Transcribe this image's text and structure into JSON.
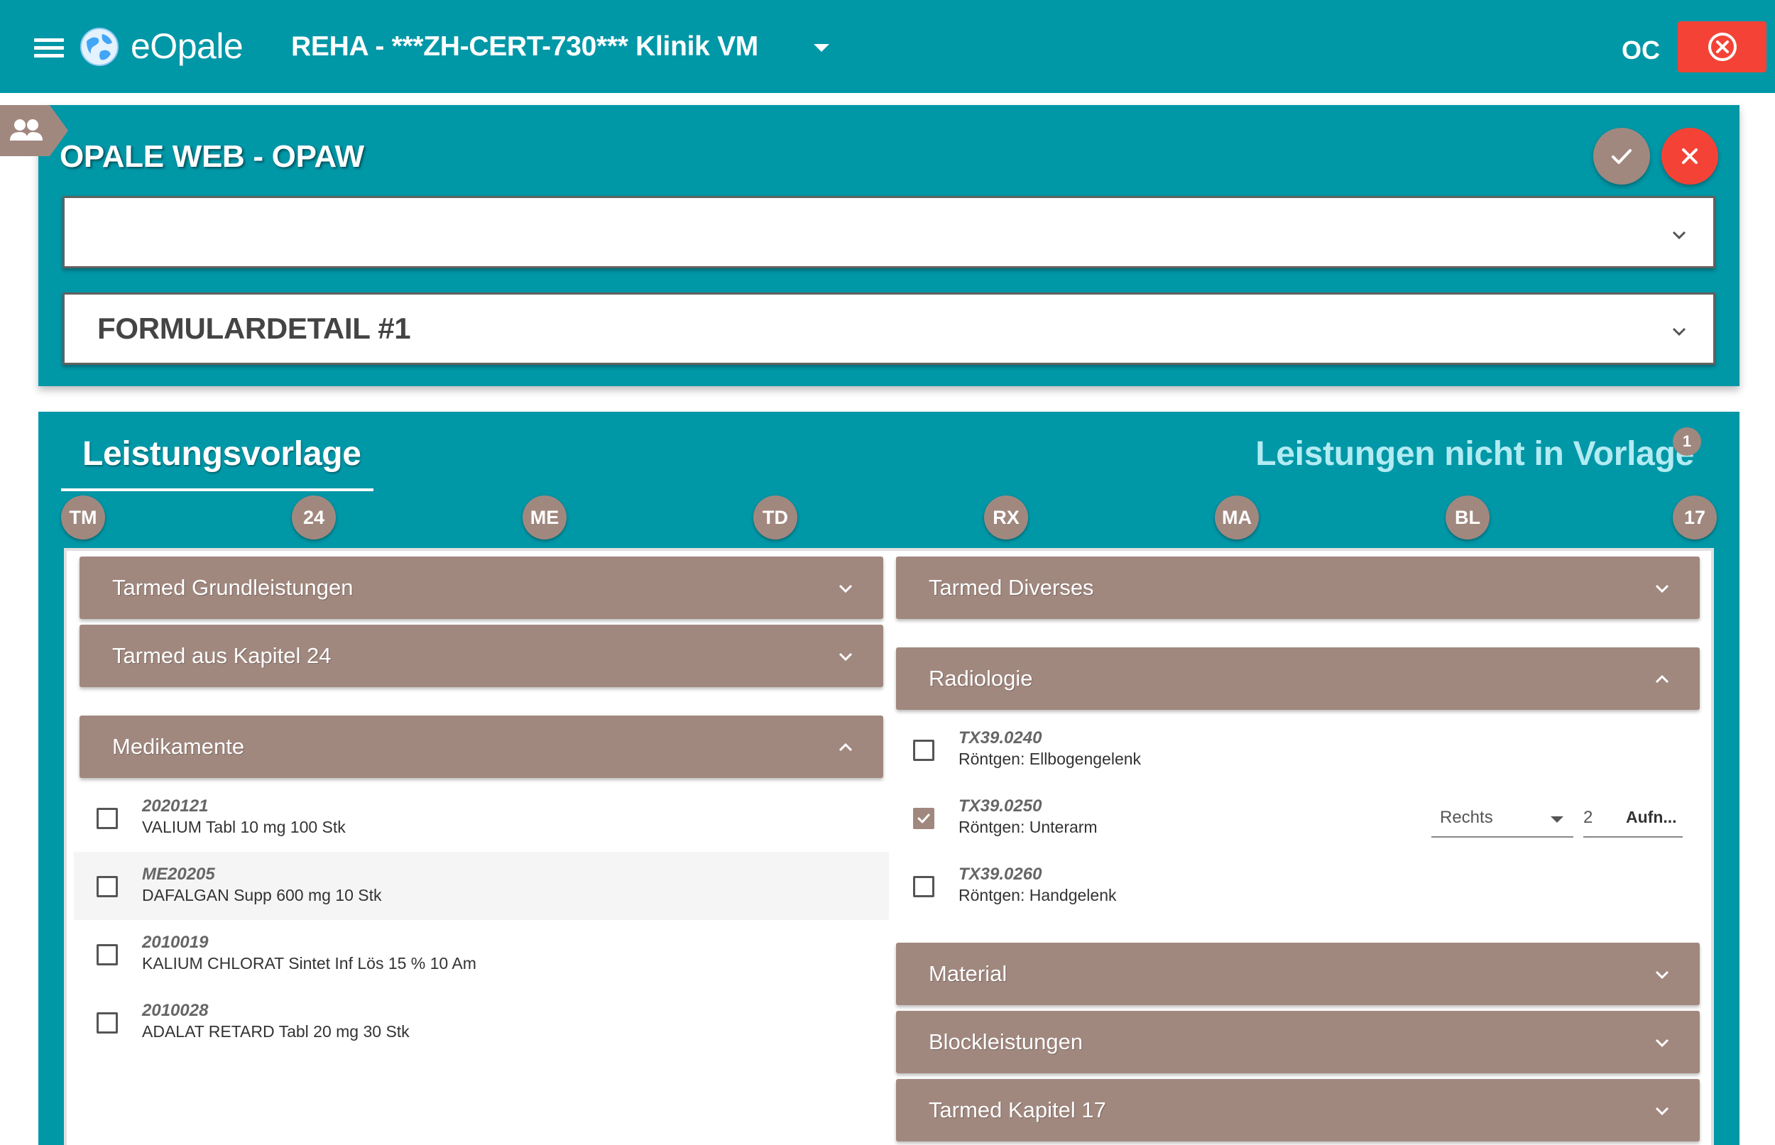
{
  "app": {
    "brand": "eOpale",
    "clinic": "REHA - ***ZH-CERT-730*** Klinik VM",
    "user_initials": "OC"
  },
  "form_panel": {
    "title": "OPALE WEB - OPAW",
    "dropdown1_value": "",
    "dropdown2_value": "FORMULARDETAIL #1"
  },
  "services": {
    "tab_active": "Leistungsvorlage",
    "tab_inactive": "Leistungen nicht in Vorlage",
    "tab_inactive_badge": "1",
    "chips": [
      "TM",
      "24",
      "ME",
      "TD",
      "RX",
      "MA",
      "BL",
      "17"
    ],
    "left": {
      "sec_grund": "Tarmed Grundleistungen",
      "sec_kap24": "Tarmed aus Kapitel 24",
      "sec_med": "Medikamente",
      "items": [
        {
          "code": "2020121",
          "desc": "VALIUM Tabl 10 mg 100 Stk"
        },
        {
          "code": "ME20205",
          "desc": "DAFALGAN Supp 600 mg 10 Stk"
        },
        {
          "code": "2010019",
          "desc": "KALIUM CHLORAT Sintet Inf Lös 15 % 10 Am"
        },
        {
          "code": "2010028",
          "desc": "ADALAT RETARD Tabl 20 mg 30 Stk"
        }
      ]
    },
    "right": {
      "sec_diverses": "Tarmed Diverses",
      "sec_radio": "Radiologie",
      "items": [
        {
          "code": "TX39.0240",
          "desc": "Röntgen: Ellbogengelenk",
          "checked": false
        },
        {
          "code": "TX39.0250",
          "desc": "Röntgen: Unterarm",
          "checked": true
        },
        {
          "code": "TX39.0260",
          "desc": "Röntgen: Handgelenk",
          "checked": false
        }
      ],
      "side_value": "Rechts",
      "quantity_value": "2",
      "aufn_label": "Aufn...",
      "sec_material": "Material",
      "sec_block": "Blockleistungen",
      "sec_kap17": "Tarmed Kapitel 17"
    }
  },
  "colors": {
    "teal": "#0097a7",
    "taupe": "#a1887f",
    "red": "#f44336"
  }
}
